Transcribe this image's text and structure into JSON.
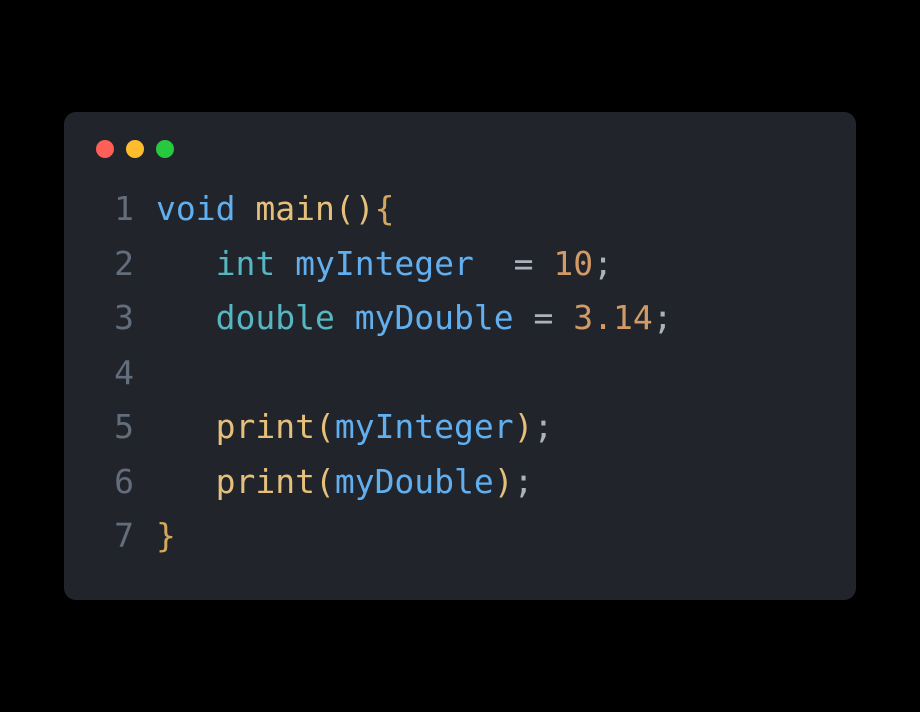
{
  "lines": {
    "l1": {
      "num": "1",
      "keyword": "void",
      "fname": "main",
      "parens": "()",
      "brace": "{"
    },
    "l2": {
      "num": "2",
      "indent": "   ",
      "type": "int",
      "sp1": " ",
      "var": "myInteger",
      "sp2": "  ",
      "eq": "=",
      "sp3": " ",
      "val": "10",
      "semi": ";"
    },
    "l3": {
      "num": "3",
      "indent": "   ",
      "type": "double",
      "sp1": " ",
      "var": "myDouble",
      "sp2": " ",
      "eq": "=",
      "sp3": " ",
      "val": "3.14",
      "semi": ";"
    },
    "l4": {
      "num": "4"
    },
    "l5": {
      "num": "5",
      "indent": "   ",
      "fname": "print",
      "open": "(",
      "arg": "myInteger",
      "close": ")",
      "semi": ";"
    },
    "l6": {
      "num": "6",
      "indent": "   ",
      "fname": "print",
      "open": "(",
      "arg": "myDouble",
      "close": ")",
      "semi": ";"
    },
    "l7": {
      "num": "7",
      "brace": "}"
    }
  }
}
